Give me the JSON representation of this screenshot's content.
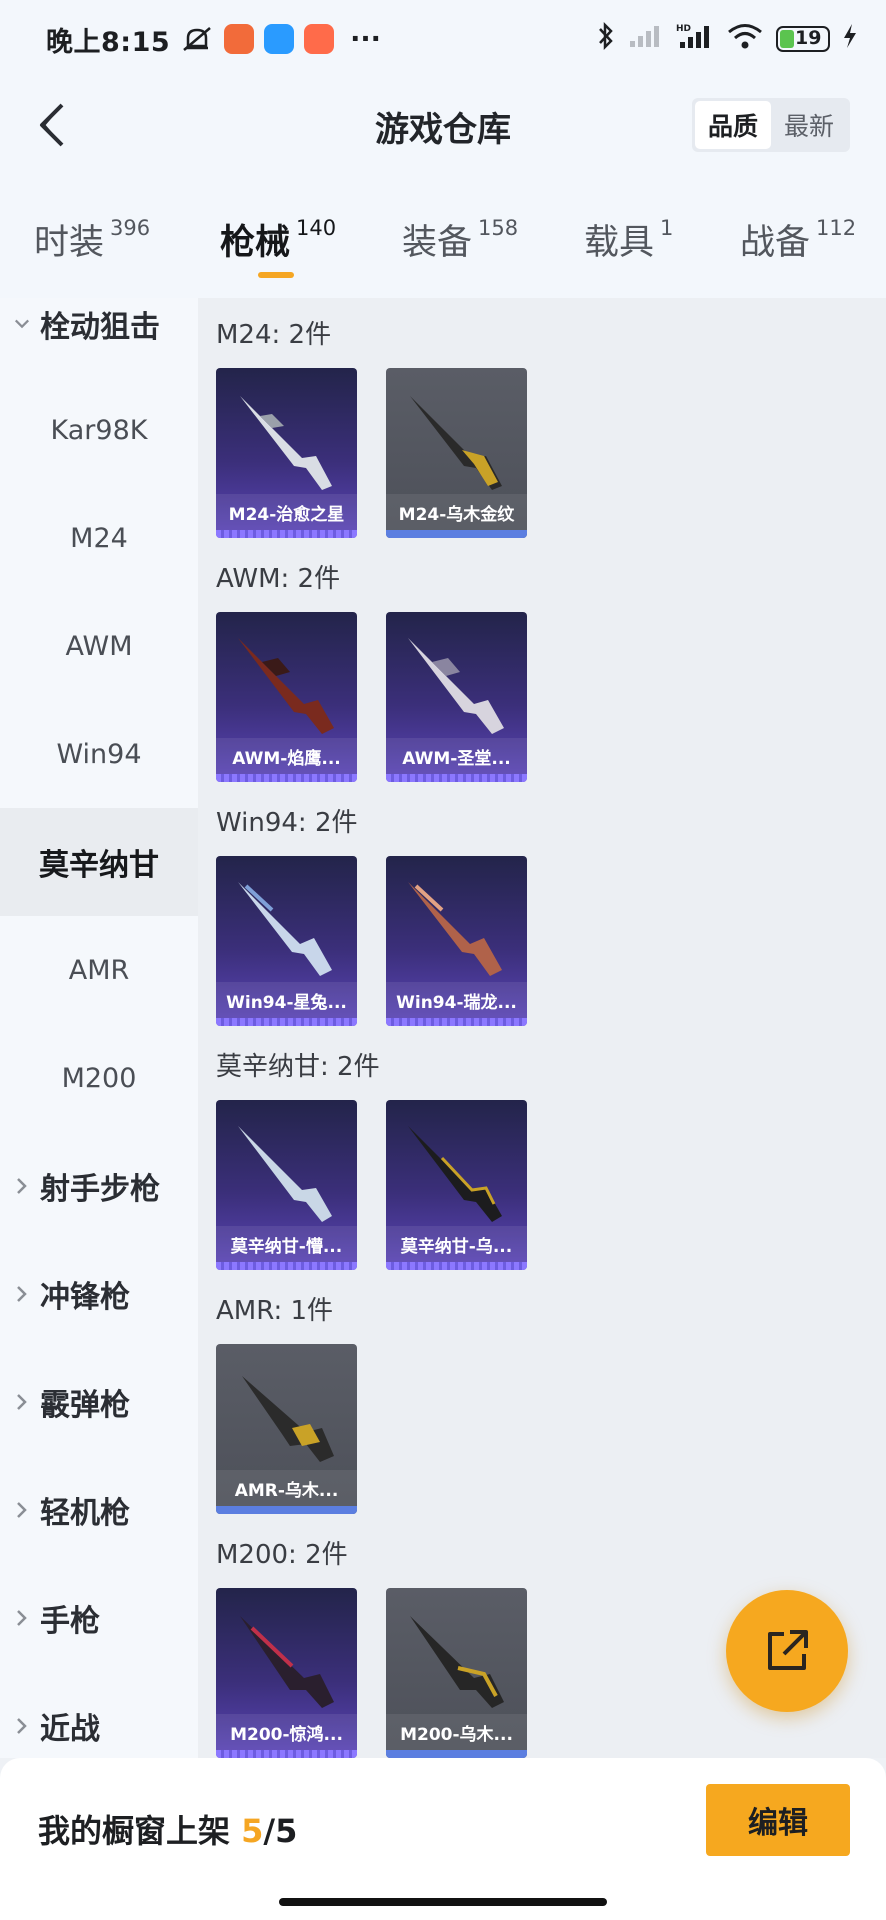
{
  "status_bar": {
    "time": "晚上8:15",
    "more": "···",
    "battery": "19"
  },
  "header": {
    "title": "游戏仓库",
    "sort_options": [
      "品质",
      "最新"
    ],
    "sort_selected": "品质"
  },
  "tabs": [
    {
      "label": "时装",
      "count": "396"
    },
    {
      "label": "枪械",
      "count": "140"
    },
    {
      "label": "装备",
      "count": "158"
    },
    {
      "label": "载具",
      "count": "1"
    },
    {
      "label": "战备",
      "count": "112"
    }
  ],
  "active_tab": "枪械",
  "sidebar": {
    "open_category": "栓动狙击",
    "subitems": [
      "Kar98K",
      "M24",
      "AWM",
      "Win94",
      "莫辛纳甘",
      "AMR",
      "M200"
    ],
    "active_subitem": "莫辛纳甘",
    "categories": [
      "射手步枪",
      "冲锋枪",
      "霰弹枪",
      "轻机枪",
      "手枪",
      "近战"
    ]
  },
  "groups": [
    {
      "title": "M24: 2件",
      "items": [
        {
          "name": "M24-治愈之星",
          "quality": "purple"
        },
        {
          "name": "M24-乌木金纹",
          "quality": "gray"
        }
      ]
    },
    {
      "title": "AWM: 2件",
      "items": [
        {
          "name": "AWM-焰鹰...",
          "quality": "purple"
        },
        {
          "name": "AWM-圣堂...",
          "quality": "purple"
        }
      ]
    },
    {
      "title": "Win94: 2件",
      "items": [
        {
          "name": "Win94-星兔...",
          "quality": "purple"
        },
        {
          "name": "Win94-瑞龙...",
          "quality": "purple"
        }
      ]
    },
    {
      "title": "莫辛纳甘: 2件",
      "items": [
        {
          "name": "莫辛纳甘-懵...",
          "quality": "purple"
        },
        {
          "name": "莫辛纳甘-乌...",
          "quality": "purple"
        }
      ]
    },
    {
      "title": "AMR: 1件",
      "items": [
        {
          "name": "AMR-乌木...",
          "quality": "gray"
        }
      ]
    },
    {
      "title": "M200: 2件",
      "items": [
        {
          "name": "M200-惊鸿...",
          "quality": "purple"
        },
        {
          "name": "M200-乌木...",
          "quality": "gray"
        }
      ]
    }
  ],
  "bottom_bar": {
    "shelf_label": "我的橱窗上架",
    "shelf_current": "5",
    "shelf_total": "/5",
    "edit_label": "编辑"
  },
  "colors": {
    "accent": "#f6a81f",
    "purple_card": "#3b2f7a",
    "gray_card": "#555861"
  }
}
